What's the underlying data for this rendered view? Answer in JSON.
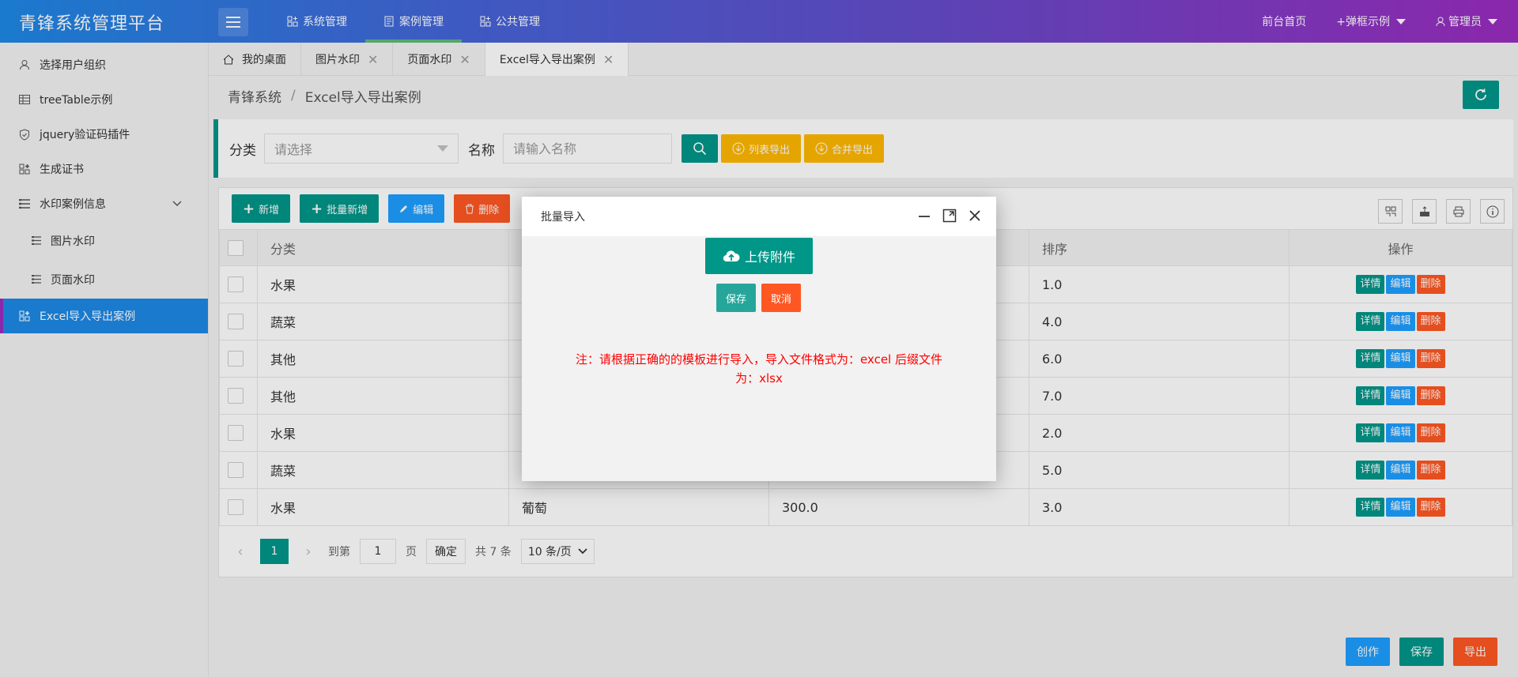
{
  "app": {
    "title": "青锋系统管理平台"
  },
  "topnav": [
    {
      "label": "系统管理",
      "icon": "grid-plus-icon",
      "active": false
    },
    {
      "label": "案例管理",
      "icon": "doc-icon",
      "active": true
    },
    {
      "label": "公共管理",
      "icon": "grid-plus-icon",
      "active": false
    }
  ],
  "topright": {
    "home": "前台首页",
    "popup_demo": "+弹框示例",
    "admin": "管理员"
  },
  "sidebar": {
    "items": [
      {
        "label": "选择用户组织",
        "icon": "user-icon"
      },
      {
        "label": "treeTable示例",
        "icon": "table-icon"
      },
      {
        "label": "jquery验证码插件",
        "icon": "shield-icon"
      },
      {
        "label": "生成证书",
        "icon": "grid-plus-icon"
      },
      {
        "label": "水印案例信息",
        "icon": "list-icon"
      },
      {
        "label": "图片水印",
        "icon": "list-icon"
      },
      {
        "label": "页面水印",
        "icon": "list-icon"
      },
      {
        "label": "Excel导入导出案例",
        "icon": "grid-plus-icon"
      }
    ]
  },
  "tabs": [
    {
      "label": "我的桌面"
    },
    {
      "label": "图片水印"
    },
    {
      "label": "页面水印"
    },
    {
      "label": "Excel导入导出案例"
    }
  ],
  "breadcrumb": {
    "root": "青锋系统",
    "sep": "/",
    "current": "Excel导入导出案例"
  },
  "search": {
    "category_label": "分类",
    "category_placeholder": "请选择",
    "name_label": "名称",
    "name_placeholder": "请输入名称",
    "list_export": "列表导出",
    "merge_export": "合并导出"
  },
  "toolbar": {
    "add": "新增",
    "batch_add": "批量新增",
    "edit": "编辑",
    "delete": "删除"
  },
  "table": {
    "headers": {
      "category": "分类",
      "sort": "排序",
      "ops": "操作"
    },
    "rows": [
      {
        "category": "水果",
        "name": "",
        "price": "",
        "sort": "1.0"
      },
      {
        "category": "蔬菜",
        "name": "",
        "price": "",
        "sort": "4.0"
      },
      {
        "category": "其他",
        "name": "",
        "price": "",
        "sort": "6.0"
      },
      {
        "category": "其他",
        "name": "",
        "price": "",
        "sort": "7.0"
      },
      {
        "category": "水果",
        "name": "",
        "price": "",
        "sort": "2.0"
      },
      {
        "category": "蔬菜",
        "name": "",
        "price": "",
        "sort": "5.0"
      },
      {
        "category": "水果",
        "name": "葡萄",
        "price": "300.0",
        "sort": "3.0"
      }
    ],
    "row_actions": {
      "detail": "详情",
      "edit": "编辑",
      "delete": "删除"
    }
  },
  "pager": {
    "current": "1",
    "goto_label": "到第",
    "goto_value": "1",
    "page_label": "页",
    "confirm": "确定",
    "total": "共 7 条",
    "page_size": "10 条/页"
  },
  "bottom": {
    "create": "创作",
    "save": "保存",
    "export": "导出"
  },
  "modal": {
    "title": "批量导入",
    "upload": "上传附件",
    "save": "保存",
    "cancel": "取消",
    "note": "注：请根据正确的的模板进行导入，导入文件格式为：excel 后缀文件为：xlsx"
  },
  "colors": {
    "teal": "#009688",
    "blue": "#1e9fff",
    "orange": "#ffb800",
    "red": "#ff5722",
    "note_red": "#ff0000"
  }
}
